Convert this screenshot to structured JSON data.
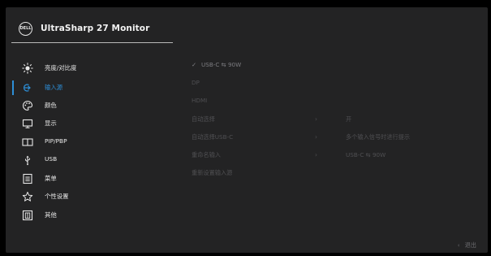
{
  "header": {
    "logo_text": "DELL",
    "title": "UltraSharp 27 Monitor"
  },
  "nav": {
    "items": [
      {
        "icon": "brightness-icon",
        "label": "亮度/对比度"
      },
      {
        "icon": "input-source-icon",
        "label": "输入源",
        "active": true
      },
      {
        "icon": "color-palette-icon",
        "label": "颜色"
      },
      {
        "icon": "display-icon",
        "label": "显示"
      },
      {
        "icon": "pip-pbp-icon",
        "label": "PIP/PBP"
      },
      {
        "icon": "usb-icon",
        "label": "USB"
      },
      {
        "icon": "menu-icon",
        "label": "菜单"
      },
      {
        "icon": "star-icon",
        "label": "个性设置"
      },
      {
        "icon": "info-icon",
        "label": "其他"
      }
    ]
  },
  "options": {
    "usbc": "USB-C ⇆ 90W",
    "dp": "DP",
    "hdmi": "HDMI",
    "auto_select": "自动选择",
    "auto_select_value": "开",
    "auto_select_usbc": "自动选择USB-C",
    "auto_select_usbc_value": "多个输入信号时进行提示",
    "rename": "重命名输入",
    "rename_value": "USB-C ⇆ 90W",
    "reset": "重新设置输入源",
    "arrow": "›",
    "check": "✓"
  },
  "footer": {
    "back_chevron": "‹",
    "exit_label": "退出"
  },
  "colors": {
    "accent": "#2d8fd8",
    "panel": "#232324",
    "background": "#000000"
  }
}
